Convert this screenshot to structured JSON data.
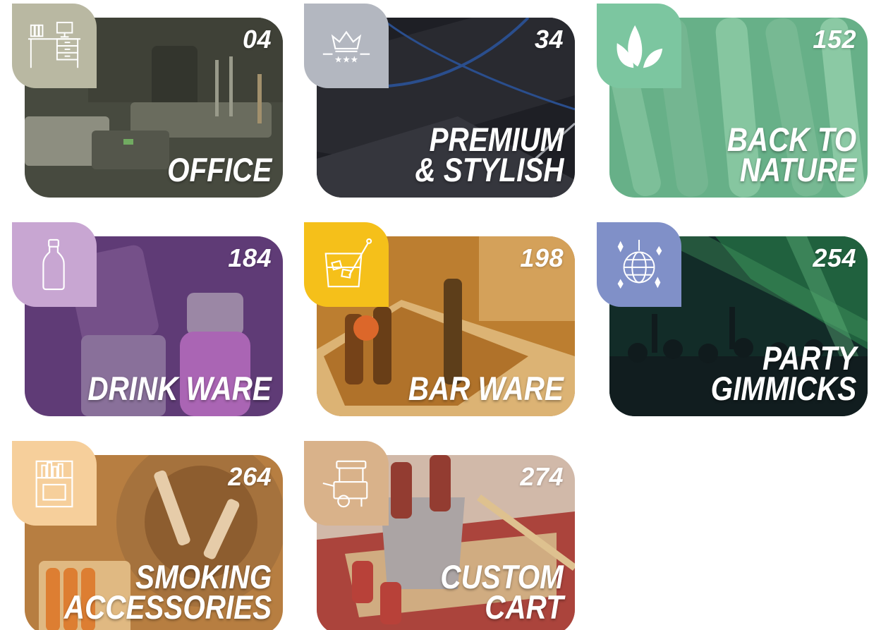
{
  "categories": [
    {
      "title_lines": [
        "OFFICE"
      ],
      "page": "04",
      "icon": "office-desk-icon",
      "icon_bg": "#b9b8a2",
      "tint": "#5e6150"
    },
    {
      "title_lines": [
        "PREMIUM",
        "& STYLISH"
      ],
      "page": "34",
      "icon": "crown-stars-icon",
      "icon_bg": "#b3b7c0",
      "tint": "#2b2c33"
    },
    {
      "title_lines": [
        "BACK TO",
        "NATURE"
      ],
      "page": "152",
      "icon": "leaves-icon",
      "icon_bg": "#7cc6a0",
      "tint": "#5aa57d"
    },
    {
      "title_lines": [
        "DRINK WARE"
      ],
      "page": "184",
      "icon": "bottle-icon",
      "icon_bg": "#c8a6d2",
      "tint": "#6b3e82"
    },
    {
      "title_lines": [
        "BAR WARE"
      ],
      "page": "198",
      "icon": "cocktail-glass-icon",
      "icon_bg": "#f5c01a",
      "tint": "#c88a2c"
    },
    {
      "title_lines": [
        "PARTY",
        "GIMMICKS"
      ],
      "page": "254",
      "icon": "disco-ball-icon",
      "icon_bg": "#8090c8",
      "tint": "#1d3a2f"
    },
    {
      "title_lines": [
        "SMOKING",
        "ACCESSORIES"
      ],
      "page": "264",
      "icon": "cigarette-pack-icon",
      "icon_bg": "#f6cf9b",
      "tint": "#c78a4a"
    },
    {
      "title_lines": [
        "CUSTOM",
        "CART"
      ],
      "page": "274",
      "icon": "food-cart-icon",
      "icon_bg": "#d9b28a",
      "tint": "#b7876c"
    }
  ]
}
